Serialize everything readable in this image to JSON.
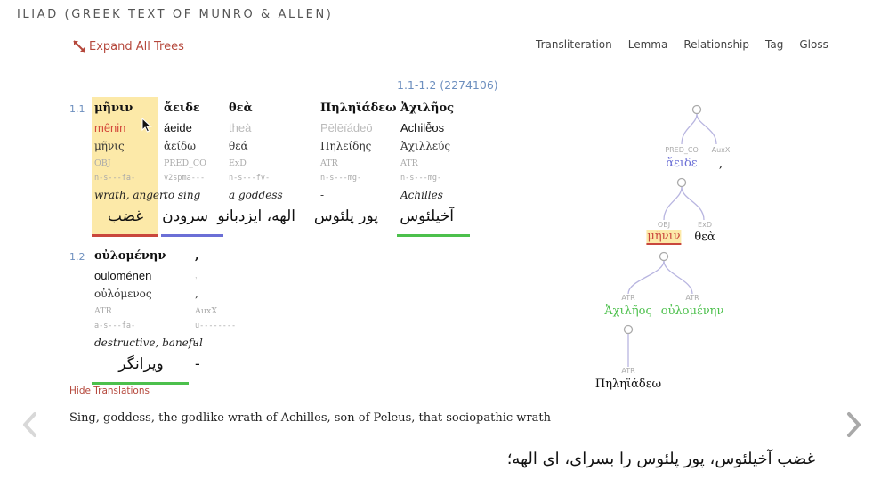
{
  "header": {
    "title": "ILIAD (GREEK TEXT OF MUNRO & ALLEN)",
    "expand_label": "Expand All Trees",
    "expand_icon": "expand-arrows-icon",
    "toolbar": [
      "Transliteration",
      "Lemma",
      "Relationship",
      "Tag",
      "Gloss"
    ]
  },
  "reference": "1.1-1.2 (2274106)",
  "lines": [
    {
      "num": "1.1",
      "words": [
        {
          "greek": "μῆνιν",
          "translit": "mênin",
          "lemma": "μῆνις",
          "rel": "OBJ",
          "tag": "n-s---fa-",
          "gloss": "wrath, anger",
          "farsi": "غضب"
        },
        {
          "greek": "ἄειδε",
          "translit": "áeide",
          "lemma": "ἀείδω",
          "rel": "PRED_CO",
          "tag": "v2spma---",
          "gloss": "to sing",
          "farsi": "سرودن"
        },
        {
          "greek": "θεὰ",
          "translit": "theà",
          "lemma": "θεά",
          "rel": "ExD",
          "tag": "n-s---fv-",
          "gloss": "a goddess",
          "farsi": "الهه، ایزدبانو"
        },
        {
          "greek": "Πηληϊάδεω",
          "translit": "Pēlēïádeō",
          "lemma": "Πηλείδης",
          "rel": "ATR",
          "tag": "n-s---mg-",
          "gloss": "-",
          "farsi": "پور پلئوس"
        },
        {
          "greek": "Ἀχιλῆος",
          "translit": "Achilê̄os",
          "lemma": "Ἀχιλλεύς",
          "rel": "ATR",
          "tag": "n-s---mg-",
          "gloss": "Achilles",
          "farsi": "آخیلئوس"
        }
      ]
    },
    {
      "num": "1.2",
      "words": [
        {
          "greek": "οὐλομένην",
          "translit": "ouloménēn",
          "lemma": "οὐλόμενος",
          "rel": "ATR",
          "tag": "a-s---fa-",
          "gloss": "destructive, baneful",
          "farsi": "ویرانگر"
        },
        {
          "greek": ",",
          "translit": ",",
          "lemma": ",",
          "rel": "AuxX",
          "tag": "u--------",
          "gloss": "-",
          "farsi": "-"
        }
      ]
    }
  ],
  "hide_translations_label": "Hide Translations",
  "translation_en": "Sing, goddess, the godlike wrath of Achilles, son of Peleus, that sociopathic wrath",
  "translation_fa": "غضب آخیلئوس، پور پلئوس را بسرای، ای الهه؛",
  "nav": {
    "prev_icon": "chevron-left-icon",
    "next_icon": "chevron-right-icon"
  },
  "tree": {
    "nodes": [
      {
        "label": "PRED_CO",
        "word": "ἄειδε"
      },
      {
        "label": "AuxX",
        "word": ","
      },
      {
        "label": "OBJ",
        "word": "μῆνιν"
      },
      {
        "label": "ExD",
        "word": "θεὰ"
      },
      {
        "label": "ATR",
        "word": "Ἀχιλῆος"
      },
      {
        "label": "ATR",
        "word": "οὐλομένην"
      },
      {
        "label": "ATR",
        "word": "Πηληϊάδεω"
      }
    ]
  },
  "colors": {
    "highlight": "#fce9a8",
    "red": "#c9473d",
    "blue": "#6b6fd6",
    "green": "#4cc04c",
    "link": "#b5483c",
    "ref": "#6d8fbf"
  }
}
